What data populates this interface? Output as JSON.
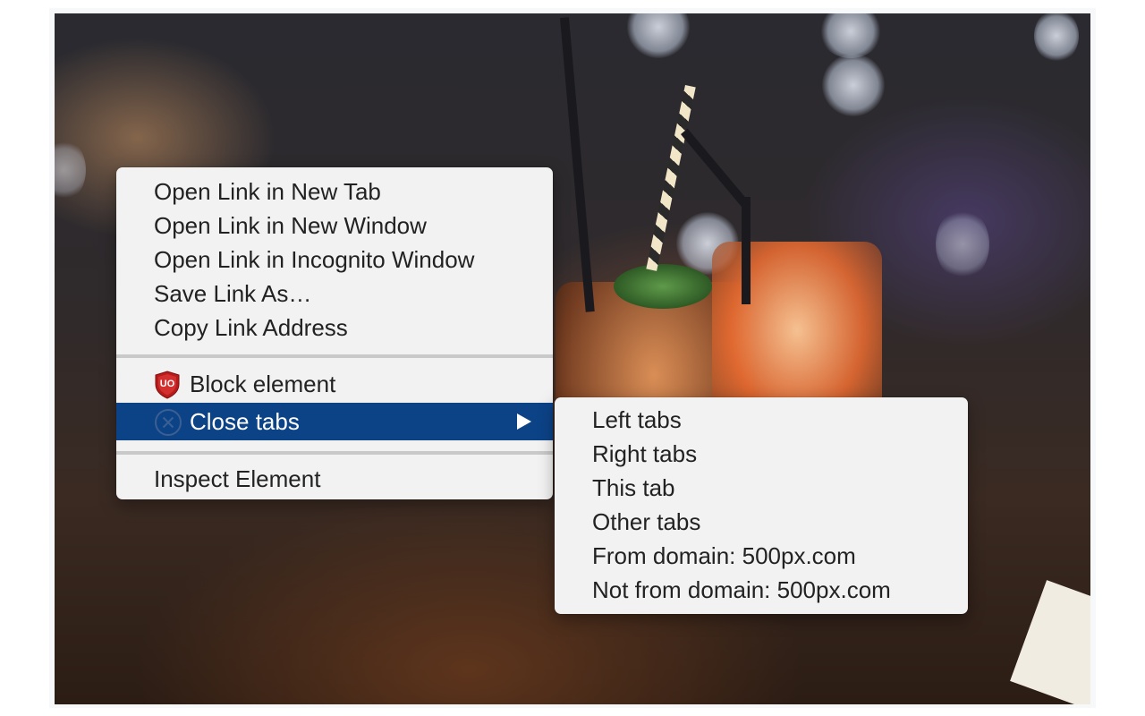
{
  "context_menu": {
    "items": [
      {
        "label": "Open Link in New Tab"
      },
      {
        "label": "Open Link in New Window"
      },
      {
        "label": "Open Link in Incognito Window"
      },
      {
        "label": "Save Link As…"
      },
      {
        "label": "Copy Link Address"
      }
    ],
    "extension_items": [
      {
        "label": "Block element",
        "icon": "ublock-origin-shield-icon",
        "icon_text": "UO",
        "icon_color": "#b71c1c"
      },
      {
        "label": "Close tabs",
        "icon": "close-circle-icon",
        "highlighted": true,
        "has_submenu": true
      }
    ],
    "inspect": {
      "label": "Inspect Element"
    }
  },
  "submenu": {
    "items": [
      {
        "label": "Left tabs"
      },
      {
        "label": "Right tabs"
      },
      {
        "label": "This tab"
      },
      {
        "label": "Other tabs"
      },
      {
        "label": "From domain: 500px.com"
      },
      {
        "label": "Not from domain: 500px.com"
      }
    ]
  },
  "colors": {
    "highlight": "#0c4387",
    "menu_background": "#f2f2f2",
    "ublock_red": "#b71c1c"
  }
}
